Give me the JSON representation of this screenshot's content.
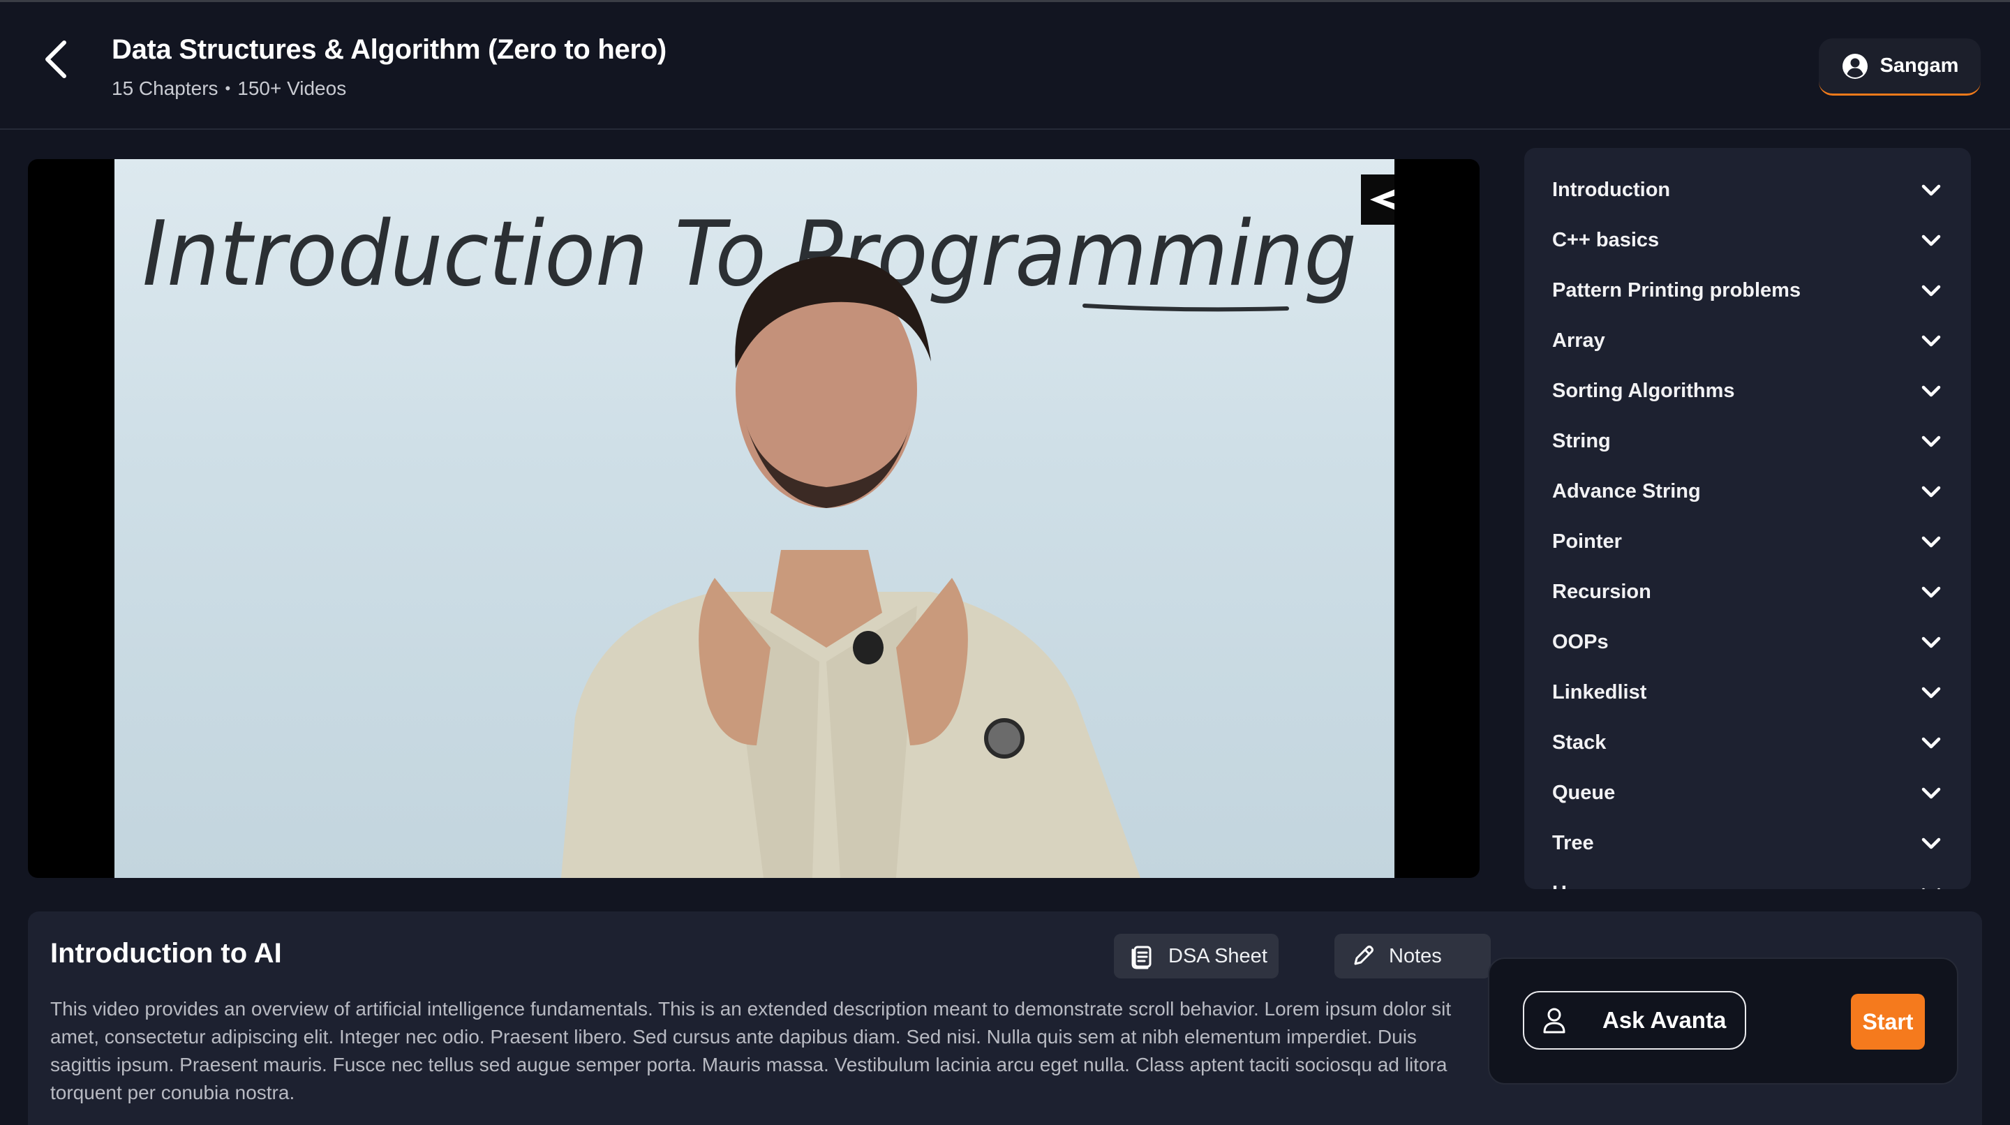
{
  "header": {
    "course_title": "Data Structures & Algorithm (Zero to hero)",
    "chapters_count": "15 Chapters",
    "separator": "•",
    "videos_count": "150+ Videos",
    "user_name": "Sangam"
  },
  "video": {
    "whiteboard_text": "Introduction To Programming"
  },
  "chapters": [
    {
      "label": "Introduction"
    },
    {
      "label": "C++ basics"
    },
    {
      "label": "Pattern Printing problems"
    },
    {
      "label": "Array"
    },
    {
      "label": "Sorting Algorithms"
    },
    {
      "label": "String"
    },
    {
      "label": "Advance String"
    },
    {
      "label": "Pointer"
    },
    {
      "label": "Recursion"
    },
    {
      "label": "OOPs"
    },
    {
      "label": "Linkedlist"
    },
    {
      "label": "Stack"
    },
    {
      "label": "Queue"
    },
    {
      "label": "Tree"
    },
    {
      "label": "H..."
    }
  ],
  "lesson": {
    "title": "Introduction to AI",
    "dsa_sheet_label": "DSA Sheet",
    "notes_label": "Notes",
    "description": "This video provides an overview of artificial intelligence fundamentals. This is an extended description meant to demonstrate scroll behavior. Lorem ipsum dolor sit amet, consectetur adipiscing elit. Integer nec odio. Praesent libero. Sed cursus ante dapibus diam. Sed nisi. Nulla quis sem at nibh elementum imperdiet. Duis sagittis ipsum. Praesent mauris. Fusce nec tellus sed augue semper porta. Mauris massa. Vestibulum lacinia arcu eget nulla. Class aptent taciti sociosqu ad litora torquent per conubia nostra."
  },
  "assistant": {
    "ask_label": "Ask Avanta",
    "start_label": "Start"
  },
  "colors": {
    "background": "#121521",
    "panel": "#1d2130",
    "accent": "#f57a1d"
  }
}
